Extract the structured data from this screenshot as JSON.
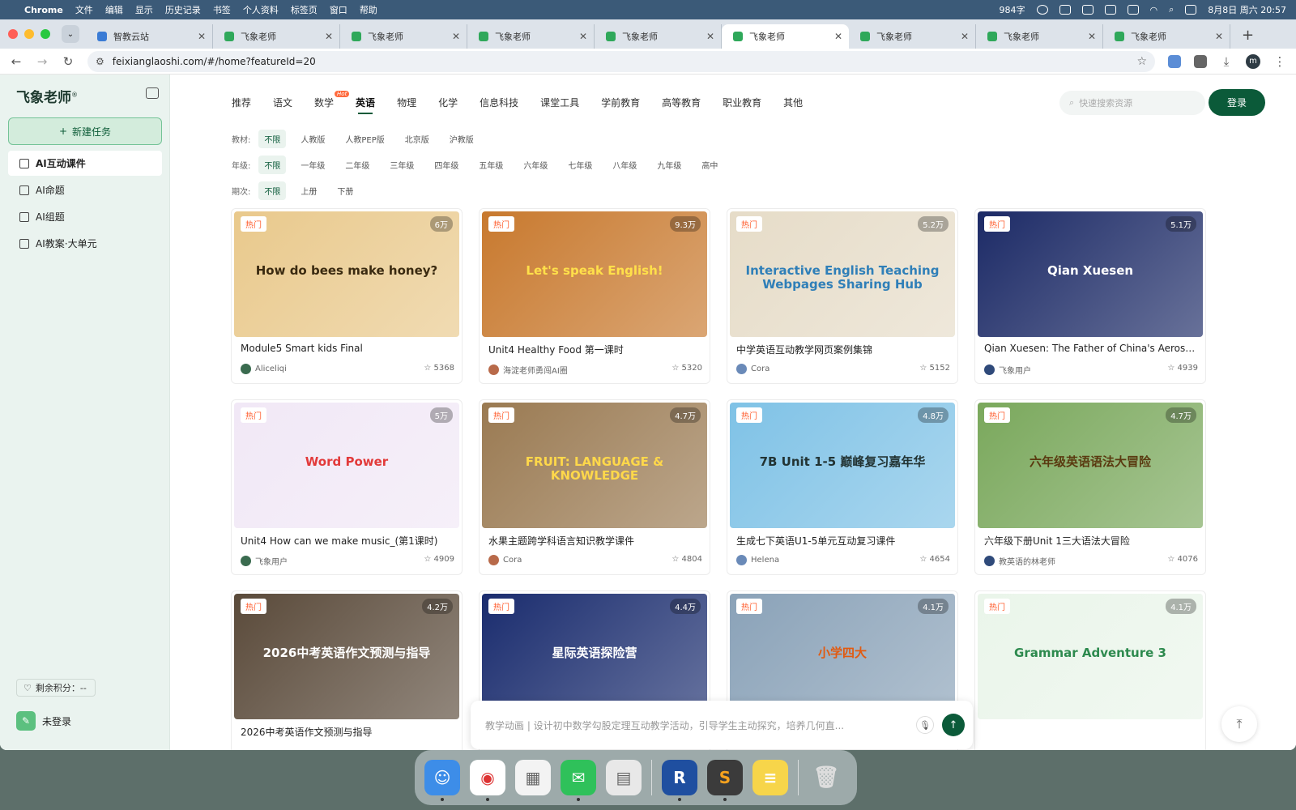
{
  "menubar": {
    "app": "Chrome",
    "items": [
      "文件",
      "编辑",
      "显示",
      "历史记录",
      "书签",
      "个人资料",
      "标签页",
      "窗口",
      "帮助"
    ],
    "wordcount": "984字",
    "datetime": "8月8日 周六 20:57"
  },
  "tabs": [
    {
      "label": "智教云站",
      "active": false
    },
    {
      "label": "飞象老师",
      "active": false
    },
    {
      "label": "飞象老师",
      "active": false
    },
    {
      "label": "飞象老师",
      "active": false
    },
    {
      "label": "飞象老师",
      "active": false
    },
    {
      "label": "飞象老师",
      "active": true
    },
    {
      "label": "飞象老师",
      "active": false
    },
    {
      "label": "飞象老师",
      "active": false
    },
    {
      "label": "飞象老师",
      "active": false
    }
  ],
  "address": {
    "url": "feixianglaoshi.com/#/home?featureId=20"
  },
  "sidebar": {
    "logo": "飞象老师",
    "new_task": "新建任务",
    "items": [
      {
        "label": "AI互动课件",
        "active": true
      },
      {
        "label": "AI命题",
        "active": false
      },
      {
        "label": "AI组题",
        "active": false
      },
      {
        "label": "AI教案·大单元",
        "active": false
      }
    ],
    "points_label": "剩余积分：--",
    "login_label": "未登录"
  },
  "header": {
    "subjects": [
      "推荐",
      "语文",
      "数学",
      "英语",
      "物理",
      "化学",
      "信息科技",
      "课堂工具",
      "学前教育",
      "高等教育",
      "职业教育",
      "其他"
    ],
    "active_subject": "英语",
    "hot_tag": "Hot",
    "search_placeholder": "快速搜索资源",
    "login": "登录"
  },
  "filters": {
    "textbook": {
      "label": "教材:",
      "options": [
        "不限",
        "人教版",
        "人教PEP版",
        "北京版",
        "沪教版"
      ],
      "selected": "不限"
    },
    "grade": {
      "label": "年级:",
      "options": [
        "不限",
        "一年级",
        "二年级",
        "三年级",
        "四年级",
        "五年级",
        "六年级",
        "七年级",
        "八年级",
        "九年级",
        "高中"
      ],
      "selected": "不限"
    },
    "term": {
      "label": "期次:",
      "options": [
        "不限",
        "上册",
        "下册"
      ],
      "selected": "不限"
    }
  },
  "hot_label": "热门",
  "cards": [
    {
      "title": "Module5 Smart kids Final",
      "author": "Aliceliqi",
      "likes": "5368",
      "views": "6万",
      "thumb_text": "How do bees make honey?",
      "bg": "#e9c98c",
      "fg": "#3a2a10"
    },
    {
      "title": "Unit4 Healthy Food 第一课时",
      "author": "海淀老师勇闯AI圈",
      "likes": "5320",
      "views": "9.3万",
      "thumb_text": "Let's speak English!",
      "bg": "#c8792e",
      "fg": "#ffe04a"
    },
    {
      "title": "中学英语互动教学网页案例集锦",
      "author": "Cora",
      "likes": "5152",
      "views": "5.2万",
      "thumb_text": "Interactive English Teaching Webpages Sharing Hub",
      "bg": "#e6dcc8",
      "fg": "#2f7fb8"
    },
    {
      "title": "Qian Xuesen: The Father of China's Aerospace",
      "author": "飞象用户",
      "likes": "4939",
      "views": "5.1万",
      "thumb_text": "Qian Xuesen",
      "bg": "#1c2a66",
      "fg": "#ffffff"
    },
    {
      "title": "Unit4 How can we make music_(第1课时)",
      "author": "飞象用户",
      "likes": "4909",
      "views": "5万",
      "thumb_text": "Word Power",
      "bg": "#f1e8f6",
      "fg": "#e23a3a"
    },
    {
      "title": "水果主题跨学科语言知识教学课件",
      "author": "Cora",
      "likes": "4804",
      "views": "4.7万",
      "thumb_text": "FRUIT: LANGUAGE & KNOWLEDGE",
      "bg": "#9a7a52",
      "fg": "#ffd84a"
    },
    {
      "title": "生成七下英语U1-5单元互动复习课件",
      "author": "Helena",
      "likes": "4654",
      "views": "4.8万",
      "thumb_text": "7B Unit 1-5 巅峰复习嘉年华",
      "bg": "#7fc2e6",
      "fg": "#233"
    },
    {
      "title": "六年级下册Unit 1三大语法大冒险",
      "author": "教英语的林老师",
      "likes": "4076",
      "views": "4.7万",
      "thumb_text": "六年级英语语法大冒险",
      "bg": "#7aa85c",
      "fg": "#5a3a10"
    },
    {
      "title": "2026中考英语作文预测与指导",
      "author": "",
      "likes": "",
      "views": "4.2万",
      "thumb_text": "2026中考英语作文预测与指导",
      "bg": "#5a4a3a",
      "fg": "#ffffff"
    },
    {
      "title": "",
      "author": "",
      "likes": "",
      "views": "4.4万",
      "thumb_text": "星际英语探险营",
      "bg": "#1a2c6e",
      "fg": "#ffffff"
    },
    {
      "title": "",
      "author": "",
      "likes": "",
      "views": "4.1万",
      "thumb_text": "小学四大",
      "bg": "#8aa2b8",
      "fg": "#e25a10"
    },
    {
      "title": "",
      "author": "",
      "likes": "",
      "views": "4.1万",
      "thumb_text": "Grammar Adventure 3",
      "bg": "#eaf5ea",
      "fg": "#2d8a4e"
    }
  ],
  "prompt": {
    "placeholder": "教学动画 | 设计初中数学勾股定理互动教学活动，引导学生主动探究，培养几何直..."
  }
}
